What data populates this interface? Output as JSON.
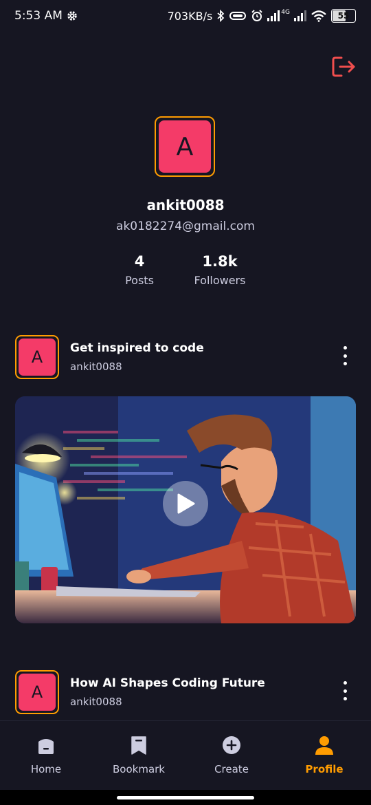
{
  "status_bar": {
    "time": "5:53 AM",
    "network_speed": "703KB/s",
    "network_badge": "4G",
    "battery": "55"
  },
  "profile": {
    "avatar_letter": "A",
    "username": "ankit0088",
    "email": "ak0182274@gmail.com",
    "stats": [
      {
        "value": "4",
        "label": "Posts"
      },
      {
        "value": "1.8k",
        "label": "Followers"
      }
    ]
  },
  "posts": [
    {
      "avatar_letter": "A",
      "title": "Get inspired to code",
      "author": "ankit0088"
    },
    {
      "avatar_letter": "A",
      "title": "How AI Shapes Coding Future",
      "author": "ankit0088"
    }
  ],
  "nav": {
    "items": [
      {
        "label": "Home",
        "icon": "home-icon"
      },
      {
        "label": "Bookmark",
        "icon": "bookmark-icon"
      },
      {
        "label": "Create",
        "icon": "plus-circle-icon"
      },
      {
        "label": "Profile",
        "icon": "profile-icon",
        "active": true
      }
    ]
  },
  "colors": {
    "background": "#161622",
    "accent": "#FF9C01",
    "avatar": "#F43B68",
    "logout": "#F04E4E"
  }
}
